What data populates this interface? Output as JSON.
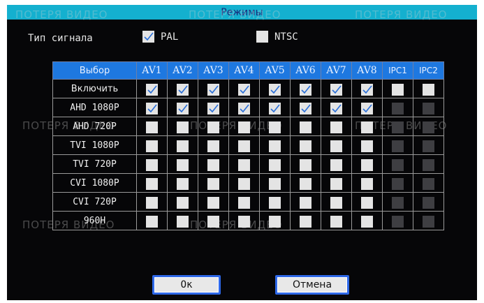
{
  "title": "Режимы",
  "watermark": "ПОТЕРЯ ВИДЕО",
  "signal": {
    "label": "Тип сигнала",
    "options": [
      {
        "name": "PAL",
        "checked": true
      },
      {
        "name": "NTSC",
        "checked": false
      }
    ]
  },
  "grid": {
    "header": [
      "Выбор",
      "AV1",
      "AV2",
      "AV3",
      "AV4",
      "AV5",
      "AV6",
      "AV7",
      "AV8",
      "IPC1",
      "IPC2"
    ],
    "rows": [
      {
        "label": "Включить",
        "states": [
          "on",
          "on",
          "on",
          "on",
          "on",
          "on",
          "on",
          "on",
          "off",
          "off"
        ]
      },
      {
        "label": "AHD 1080P",
        "states": [
          "on",
          "on",
          "on",
          "on",
          "on",
          "on",
          "on",
          "on",
          "disabled",
          "disabled"
        ]
      },
      {
        "label": "AHD 720P",
        "states": [
          "off",
          "off",
          "off",
          "off",
          "off",
          "off",
          "off",
          "off",
          "disabled",
          "disabled"
        ]
      },
      {
        "label": "TVI 1080P",
        "states": [
          "off",
          "off",
          "off",
          "off",
          "off",
          "off",
          "off",
          "off",
          "disabled",
          "disabled"
        ]
      },
      {
        "label": "TVI 720P",
        "states": [
          "off",
          "off",
          "off",
          "off",
          "off",
          "off",
          "off",
          "off",
          "disabled",
          "disabled"
        ]
      },
      {
        "label": "CVI 1080P",
        "states": [
          "off",
          "off",
          "off",
          "off",
          "off",
          "off",
          "off",
          "off",
          "disabled",
          "disabled"
        ]
      },
      {
        "label": "CVI 720P",
        "states": [
          "off",
          "off",
          "off",
          "off",
          "off",
          "off",
          "off",
          "off",
          "disabled",
          "disabled"
        ]
      },
      {
        "label": "960H",
        "states": [
          "off",
          "off",
          "off",
          "off",
          "off",
          "off",
          "off",
          "off",
          "disabled",
          "disabled"
        ]
      }
    ]
  },
  "buttons": {
    "ok": "Ок",
    "cancel": "Отмена"
  },
  "colors": {
    "title_bar": "#14b0cf",
    "header_row": "#1e78e0",
    "checkbox": "#e4e4e4",
    "checkbox_disabled": "#3e3e42",
    "check_mark": "#2a6fd8",
    "button_border": "#2e68e8"
  }
}
